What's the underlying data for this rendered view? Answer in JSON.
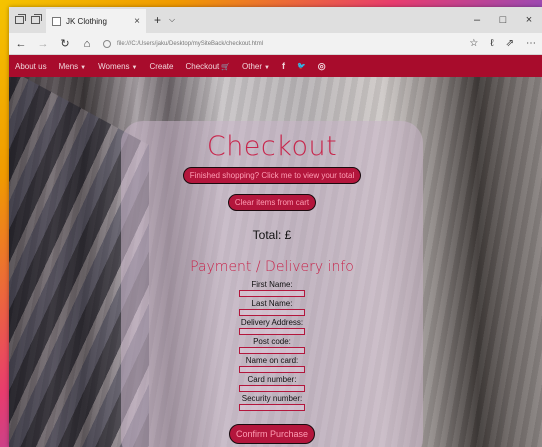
{
  "browser": {
    "tab_title": "JK Clothing",
    "tab_close": "×",
    "new_tab": "+",
    "tab_menu": "⌵",
    "window_minimize": "–",
    "window_maximize": "□",
    "window_close": "×",
    "url": "file:///C:/Users/jaku/Desktop/mySiteBack/checkout.html"
  },
  "nav": {
    "items": [
      {
        "label": "About us",
        "caret": ""
      },
      {
        "label": "Mens",
        "caret": "▼"
      },
      {
        "label": "Womens",
        "caret": "▼"
      },
      {
        "label": "Create",
        "caret": ""
      },
      {
        "label": "Checkout",
        "caret": "🛒"
      },
      {
        "label": "Other",
        "caret": "▼"
      }
    ],
    "social": [
      "f",
      "🐦",
      "◎"
    ]
  },
  "checkout": {
    "title": "Checkout",
    "view_total_button": "Finished shopping? Click me to view your total",
    "clear_button": "Clear items from cart",
    "total_label": "Total: £",
    "payment_title": "Payment / Delivery info",
    "fields": [
      {
        "label": "First Name:",
        "value": ""
      },
      {
        "label": "Last Name:",
        "value": ""
      },
      {
        "label": "Delivery Address:",
        "value": ""
      },
      {
        "label": "Post code:",
        "value": ""
      },
      {
        "label": "Name on card:",
        "value": ""
      },
      {
        "label": "Card number:",
        "value": ""
      },
      {
        "label": "Security number:",
        "value": ""
      }
    ],
    "confirm_button": "Confirm Purchase"
  },
  "colors": {
    "navbar": "#a80c2c",
    "accent": "#c8264c",
    "button_bg": "#b3163c",
    "button_text": "#ff9db4"
  }
}
